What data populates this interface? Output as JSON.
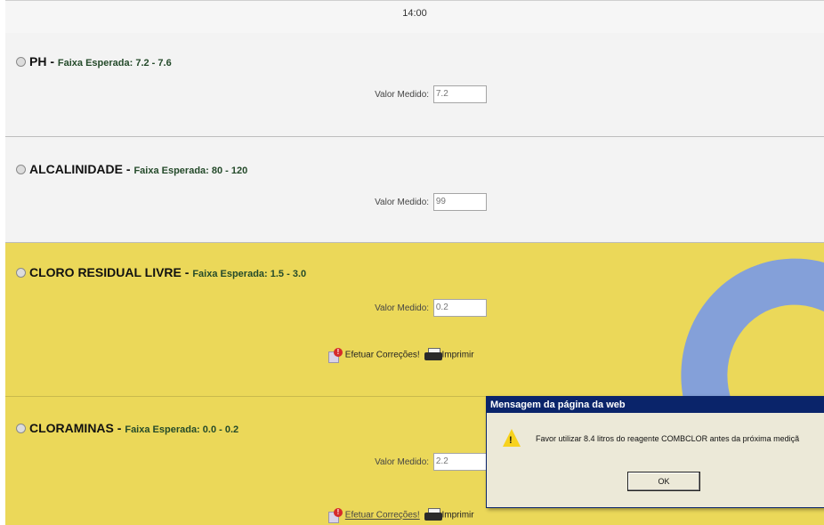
{
  "header": {
    "time": "14:00"
  },
  "sections": [
    {
      "name": "PH",
      "range": "Faixa Esperada: 7.2 - 7.6",
      "field_label": "Valor Medido:",
      "value": "7.2"
    },
    {
      "name": "ALCALINIDADE",
      "range": "Faixa Esperada: 80 - 120",
      "field_label": "Valor Medido:",
      "value": "99"
    },
    {
      "name": "CLORO RESIDUAL LIVRE",
      "range": "Faixa Esperada: 1.5 - 3.0",
      "field_label": "Valor Medido:",
      "value": "0.2",
      "actions": {
        "corrections": "Efetuar Correções!",
        "print": "Imprimir"
      }
    },
    {
      "name": "CLORAMINAS",
      "range": "Faixa Esperada: 0.0 - 0.2",
      "field_label": "Valor Medido:",
      "value": "2.2",
      "actions": {
        "corrections": "Efetuar Correções!",
        "print": "Imprimir"
      }
    }
  ],
  "dialog": {
    "title": "Mensagem da página da web",
    "message": "Favor utilizar 8.4 litros do reagente COMBCLOR antes da próxima mediçã",
    "ok_label": "OK"
  },
  "colors": {
    "highlight": "#ebd859",
    "normal": "#f3f3f3",
    "dialog_title": "#0a246a",
    "arrow": "#7f9ee0"
  },
  "icons": {
    "warning": "warning-icon",
    "print": "printer-icon",
    "bullet": "radio-bullet-icon"
  }
}
